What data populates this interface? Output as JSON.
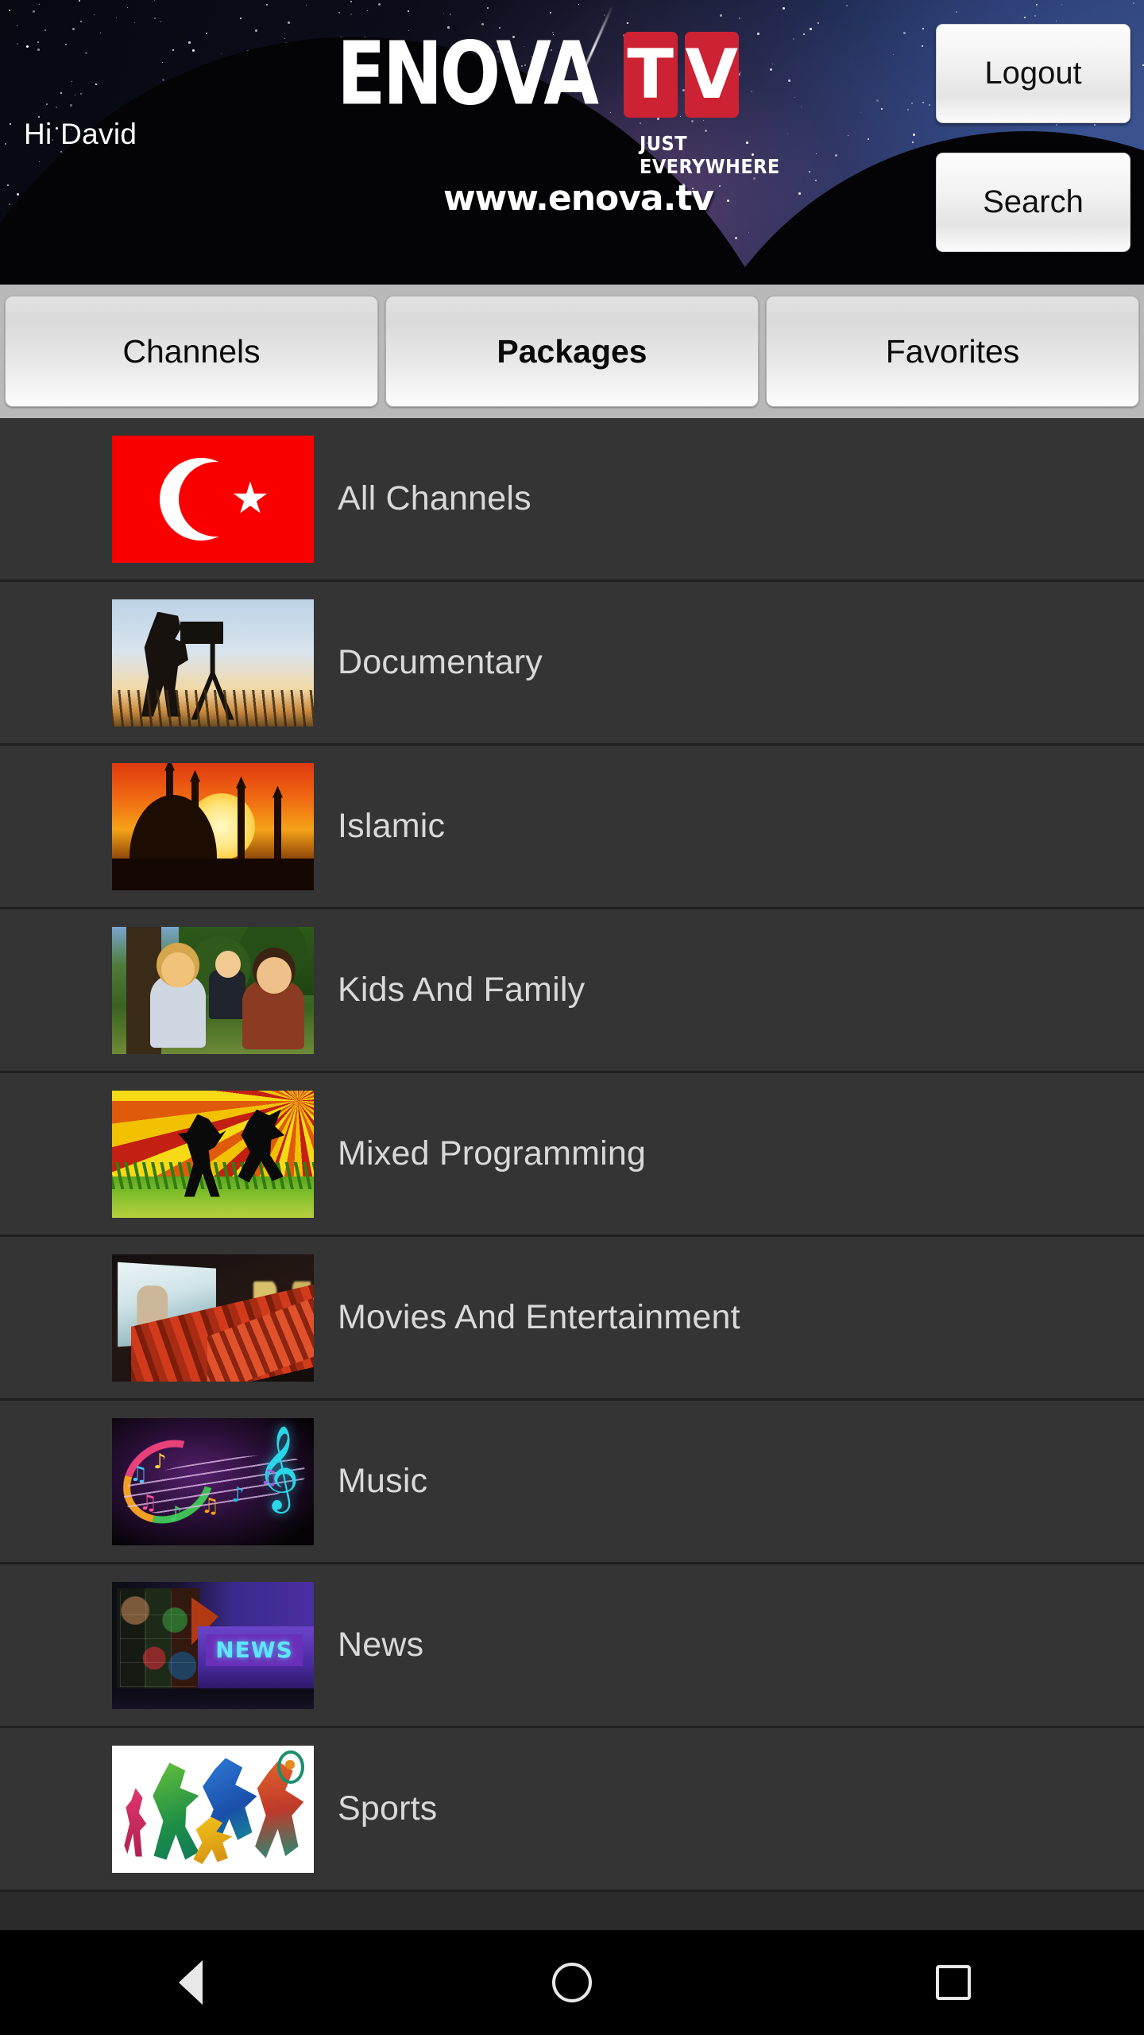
{
  "header": {
    "greeting": "Hi David",
    "logo_text": "ENOVA",
    "logo_tv": [
      "T",
      "V"
    ],
    "tagline": "JUST EVERYWHERE",
    "website": "www.enova.tv",
    "logout_label": "Logout",
    "search_label": "Search",
    "accent_red": "#cc2233"
  },
  "tabs": [
    {
      "label": "Channels",
      "active": false
    },
    {
      "label": "Packages",
      "active": true
    },
    {
      "label": "Favorites",
      "active": false
    }
  ],
  "list": {
    "items": [
      {
        "label": "All Channels",
        "thumb": "turkish-flag-thumbnail"
      },
      {
        "label": "Documentary",
        "thumb": "documentary-photographer-thumbnail"
      },
      {
        "label": "Islamic",
        "thumb": "mosque-sunset-thumbnail"
      },
      {
        "label": "Kids And Family",
        "thumb": "family-outdoors-thumbnail"
      },
      {
        "label": "Mixed Programming",
        "thumb": "dancing-silhouettes-thumbnail"
      },
      {
        "label": "Movies And Entertainment",
        "thumb": "cinema-theater-thumbnail"
      },
      {
        "label": "Music",
        "thumb": "music-notes-thumbnail"
      },
      {
        "label": "News",
        "thumb": "news-studio-thumbnail"
      },
      {
        "label": "Sports",
        "thumb": "sports-athletes-thumbnail"
      }
    ]
  },
  "navbar": {
    "back_label": "Back",
    "home_label": "Home",
    "recents_label": "Recents"
  }
}
